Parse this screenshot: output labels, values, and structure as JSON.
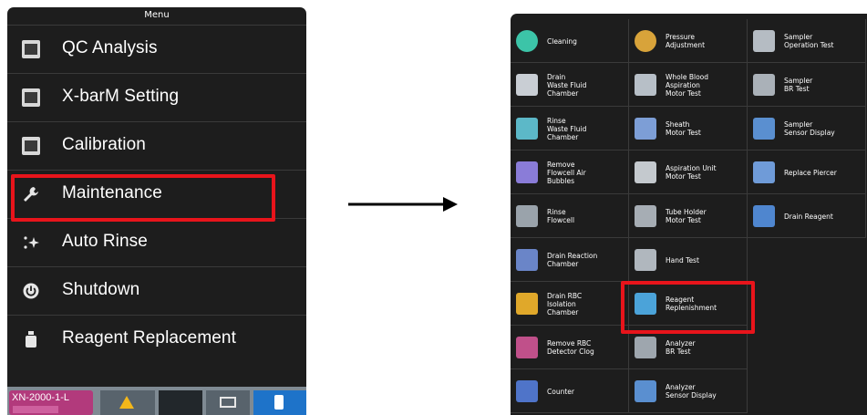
{
  "menu": {
    "title": "Menu",
    "items": [
      {
        "label": "QC Analysis",
        "icon": "qc-analysis-icon"
      },
      {
        "label": "X-barM Setting",
        "icon": "xbarm-icon"
      },
      {
        "label": "Calibration",
        "icon": "calibration-icon"
      },
      {
        "label": "Maintenance",
        "icon": "wrench-icon"
      },
      {
        "label": "Auto Rinse",
        "icon": "sparkle-icon"
      },
      {
        "label": "Shutdown",
        "icon": "power-icon"
      },
      {
        "label": "Reagent Replacement",
        "icon": "reagent-bottle-icon"
      }
    ],
    "highlighted_item": "Maintenance"
  },
  "status_bar": {
    "analyzer": "XN-2000-1-L",
    "tabs": [
      "warning-icon",
      "blank",
      "rack-icon",
      "bottle-icon"
    ]
  },
  "grid": {
    "highlighted_item": "Reagent Replenishment",
    "columns": [
      [
        {
          "label": "Cleaning",
          "icon": "cleaning-icon"
        },
        {
          "label": "Drain\nWaste Fluid\nChamber",
          "icon": "drain-waste-icon"
        },
        {
          "label": "Rinse\nWaste Fluid\nChamber",
          "icon": "rinse-waste-icon"
        },
        {
          "label": "Remove\nFlowcell Air\nBubbles",
          "icon": "air-bubbles-icon"
        },
        {
          "label": "Rinse\nFlowcell",
          "icon": "rinse-flowcell-icon"
        },
        {
          "label": "Drain Reaction\nChamber",
          "icon": "drain-reaction-icon"
        },
        {
          "label": "Drain RBC\nIsolation\nChamber",
          "icon": "drain-rbc-icon"
        },
        {
          "label": "Remove RBC\nDetector Clog",
          "icon": "remove-clog-icon"
        },
        {
          "label": "Counter",
          "icon": "counter-icon"
        }
      ],
      [
        {
          "label": "Pressure\nAdjustment",
          "icon": "pressure-gauge-icon"
        },
        {
          "label": "Whole Blood\nAspiration\nMotor Test",
          "icon": "aspiration-motor-icon"
        },
        {
          "label": "Sheath\nMotor Test",
          "icon": "sheath-motor-icon"
        },
        {
          "label": "Aspiration Unit\nMotor Test",
          "icon": "aspiration-unit-icon"
        },
        {
          "label": "Tube Holder\nMotor Test",
          "icon": "tube-holder-icon"
        },
        {
          "label": "Hand Test",
          "icon": "hand-test-icon"
        },
        {
          "label": "Reagent\nReplenishment",
          "icon": "reagent-replenishment-icon"
        },
        {
          "label": "Analyzer\nBR Test",
          "icon": "analyzer-br-icon"
        },
        {
          "label": "Analyzer\nSensor Display",
          "icon": "analyzer-sensor-icon"
        }
      ],
      [
        {
          "label": "Sampler\nOperation Test",
          "icon": "sampler-operation-icon"
        },
        {
          "label": "Sampler\nBR Test",
          "icon": "sampler-br-icon"
        },
        {
          "label": "Sampler\nSensor Display",
          "icon": "sampler-sensor-icon"
        },
        {
          "label": "Replace Piercer",
          "icon": "replace-piercer-icon"
        },
        {
          "label": "Drain Reagent",
          "icon": "drain-reagent-icon"
        }
      ]
    ]
  },
  "colors": {
    "highlight": "#e8141b",
    "panel": "#1d1d1d",
    "status_active": "#1e73c9",
    "analyzer_badge": "#b23a7c",
    "warning": "#f3b71a"
  }
}
